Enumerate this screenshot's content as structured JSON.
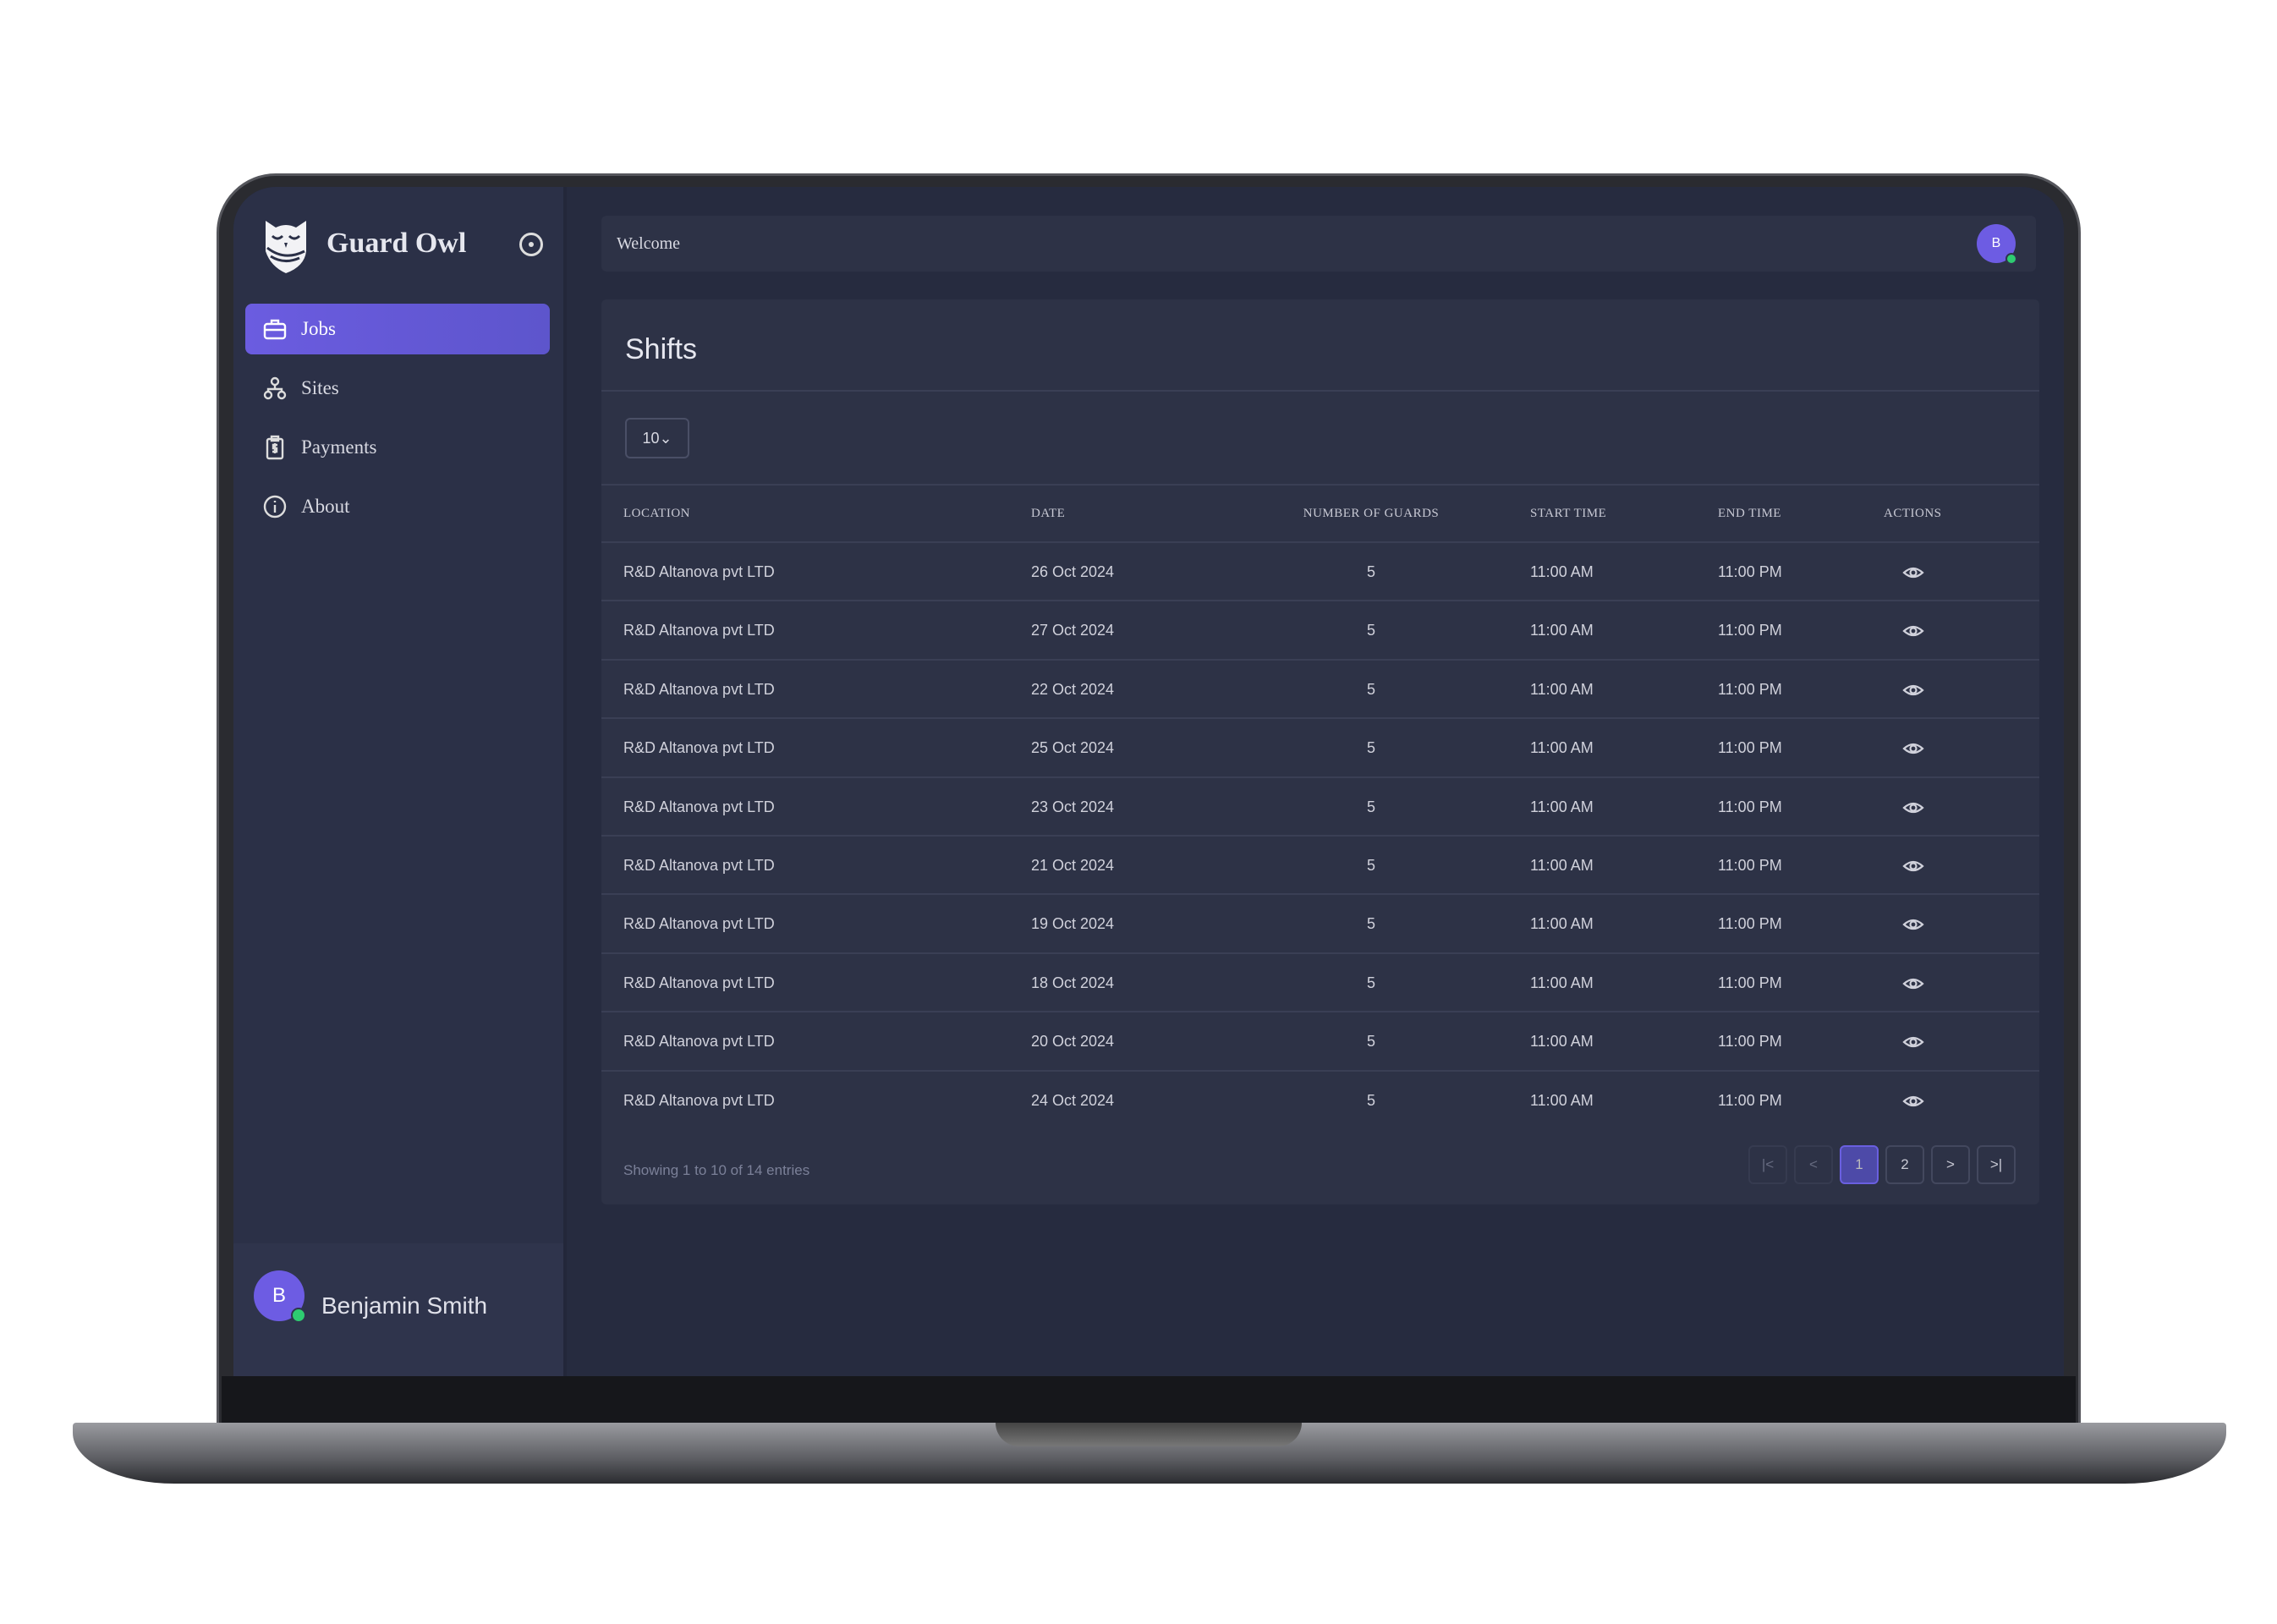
{
  "app": {
    "brand": "Guard Owl"
  },
  "sidebar": {
    "items": [
      {
        "label": "Jobs",
        "icon": "briefcase-icon",
        "active": true
      },
      {
        "label": "Sites",
        "icon": "sitemap-icon"
      },
      {
        "label": "Payments",
        "icon": "clipboard-dollar-icon"
      },
      {
        "label": "About",
        "icon": "info-icon"
      }
    ],
    "user": {
      "initial": "B",
      "name": "Benjamin Smith",
      "status": "online"
    }
  },
  "topbar": {
    "welcome": "Welcome",
    "avatar_initial": "B"
  },
  "colors": {
    "accent": "#6b5ce0",
    "background": "#262b3f",
    "online": "#2ecc71"
  },
  "main": {
    "title": "Shifts",
    "page_size": "10",
    "columns": [
      "LOCATION",
      "DATE",
      "NUMBER OF GUARDS",
      "START TIME",
      "END TIME",
      "ACTIONS"
    ],
    "rows": [
      [
        "R&D Altanova pvt LTD",
        "26 Oct 2024",
        "5",
        "11:00 AM",
        "11:00 PM"
      ],
      [
        "R&D Altanova pvt LTD",
        "27 Oct 2024",
        "5",
        "11:00 AM",
        "11:00 PM"
      ],
      [
        "R&D Altanova pvt LTD",
        "22 Oct 2024",
        "5",
        "11:00 AM",
        "11:00 PM"
      ],
      [
        "R&D Altanova pvt LTD",
        "25 Oct 2024",
        "5",
        "11:00 AM",
        "11:00 PM"
      ],
      [
        "R&D Altanova pvt LTD",
        "23 Oct 2024",
        "5",
        "11:00 AM",
        "11:00 PM"
      ],
      [
        "R&D Altanova pvt LTD",
        "21 Oct 2024",
        "5",
        "11:00 AM",
        "11:00 PM"
      ],
      [
        "R&D Altanova pvt LTD",
        "19 Oct 2024",
        "5",
        "11:00 AM",
        "11:00 PM"
      ],
      [
        "R&D Altanova pvt LTD",
        "18 Oct 2024",
        "5",
        "11:00 AM",
        "11:00 PM"
      ],
      [
        "R&D Altanova pvt LTD",
        "20 Oct 2024",
        "5",
        "11:00 AM",
        "11:00 PM"
      ],
      [
        "R&D Altanova pvt LTD",
        "24 Oct 2024",
        "5",
        "11:00 AM",
        "11:00 PM"
      ]
    ],
    "entries_info": "Showing 1 to 10 of 14 entries",
    "pagination": {
      "first": "|<",
      "prev": "<",
      "pages": [
        "1",
        "2"
      ],
      "current": "1",
      "next": ">",
      "last": ">|"
    }
  }
}
